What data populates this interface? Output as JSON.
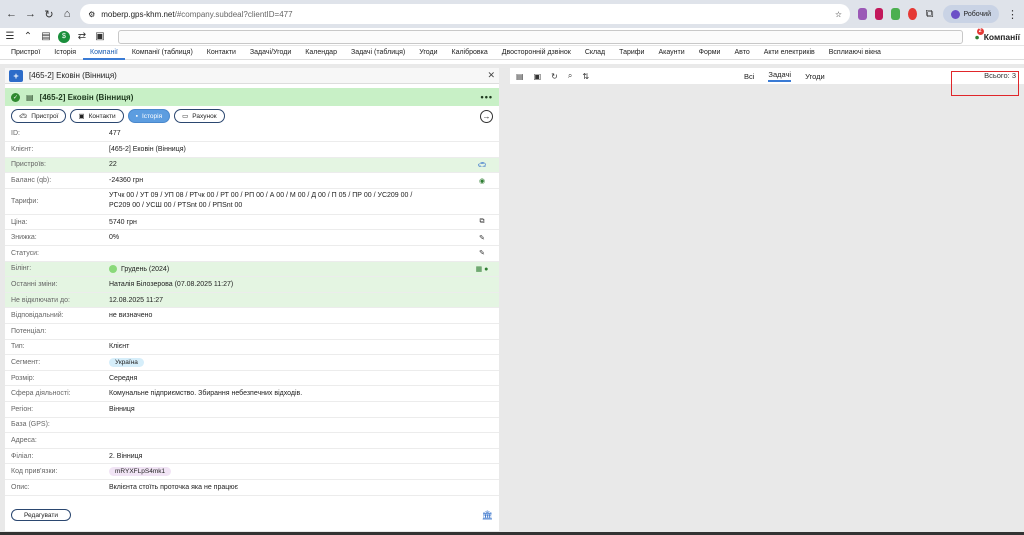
{
  "browser": {
    "url_host": "moberp.gps-khm.net",
    "url_path": "/#company.subdeal?clientID=477",
    "profile_label": "Робочий"
  },
  "appbar": {
    "companies_label": "Компанії",
    "notif_count": "2"
  },
  "menu": [
    "Пристрої",
    "Історія",
    "Компанії",
    "Компанії (таблиця)",
    "Контакти",
    "Задачі/Угоди",
    "Календар",
    "Задачі (таблиця)",
    "Угоди",
    "Калібровка",
    "Двосторонній дзвінок",
    "Склад",
    "Тарифи",
    "Акаунти",
    "Форми",
    "Авто",
    "Акти електриків",
    "Всплиаючі вікна"
  ],
  "panel": {
    "title": "[465-2] Ековін (Вінниця)",
    "card_title": "[465-2] Ековін (Вінниця)",
    "tabs": [
      "Пристрої",
      "Контакти",
      "Історія",
      "Рахунок"
    ],
    "rows": [
      {
        "label": "ID:",
        "value": "477"
      },
      {
        "label": "Клієнт:",
        "value": "[465-2] Ековін (Вінниця)"
      },
      {
        "label": "Пристроїв:",
        "value": "22"
      },
      {
        "label": "Баланс (qb):",
        "value": "-24360 грн"
      },
      {
        "label": "Тарифи:",
        "value": "УТчк 00  /  УТ 09  /  УП 08  /  РТчк 00  /  РТ 00  /  РП 00  /  А 00  /  М 00  /  Д 00  /  П 05  /  ПР 00  /  УС209 00  /  РС209 00  /  УСШ 00  /  PTSnt 00  /  PПSnt 00"
      },
      {
        "label": "Ціна:",
        "value": "5740 грн"
      },
      {
        "label": "Знижка:",
        "value": "0%"
      },
      {
        "label": "Статуси:",
        "value": ""
      },
      {
        "label": "Білінг:",
        "value": "Грудень (2024)"
      },
      {
        "label": "Останні зміни:",
        "value": "Наталія Білозерова  (07.08.2025 11:27)"
      },
      {
        "label": "Не відключати до:",
        "value": "12.08.2025 11:27"
      },
      {
        "label": "Відповідальний:",
        "value": "не визначено"
      },
      {
        "label": "Потенціал:",
        "value": ""
      },
      {
        "label": "Тип:",
        "value": "Клієнт"
      },
      {
        "label": "Сегмент:",
        "value": "Україна"
      },
      {
        "label": "Розмір:",
        "value": "Середня"
      },
      {
        "label": "Сфера діяльності:",
        "value": "Комунальне підприємство. Збирання небезпечних відходів."
      },
      {
        "label": "Регіон:",
        "value": "Вінниця"
      },
      {
        "label": "База (GPS):",
        "value": ""
      },
      {
        "label": "Адреса:",
        "value": ""
      },
      {
        "label": "Філіал:",
        "value": "2. Вінниця"
      },
      {
        "label": "Код прив'язки:",
        "value": "mRYXFLpS4mk1"
      },
      {
        "label": "Опис:",
        "value": "Вклієнта стоїть проточка яка не працює"
      }
    ],
    "edit_label": "Редагувати"
  },
  "right": {
    "tabs": [
      "Всі",
      "Задачі",
      "Угоди"
    ],
    "total": "Всього: 3"
  }
}
